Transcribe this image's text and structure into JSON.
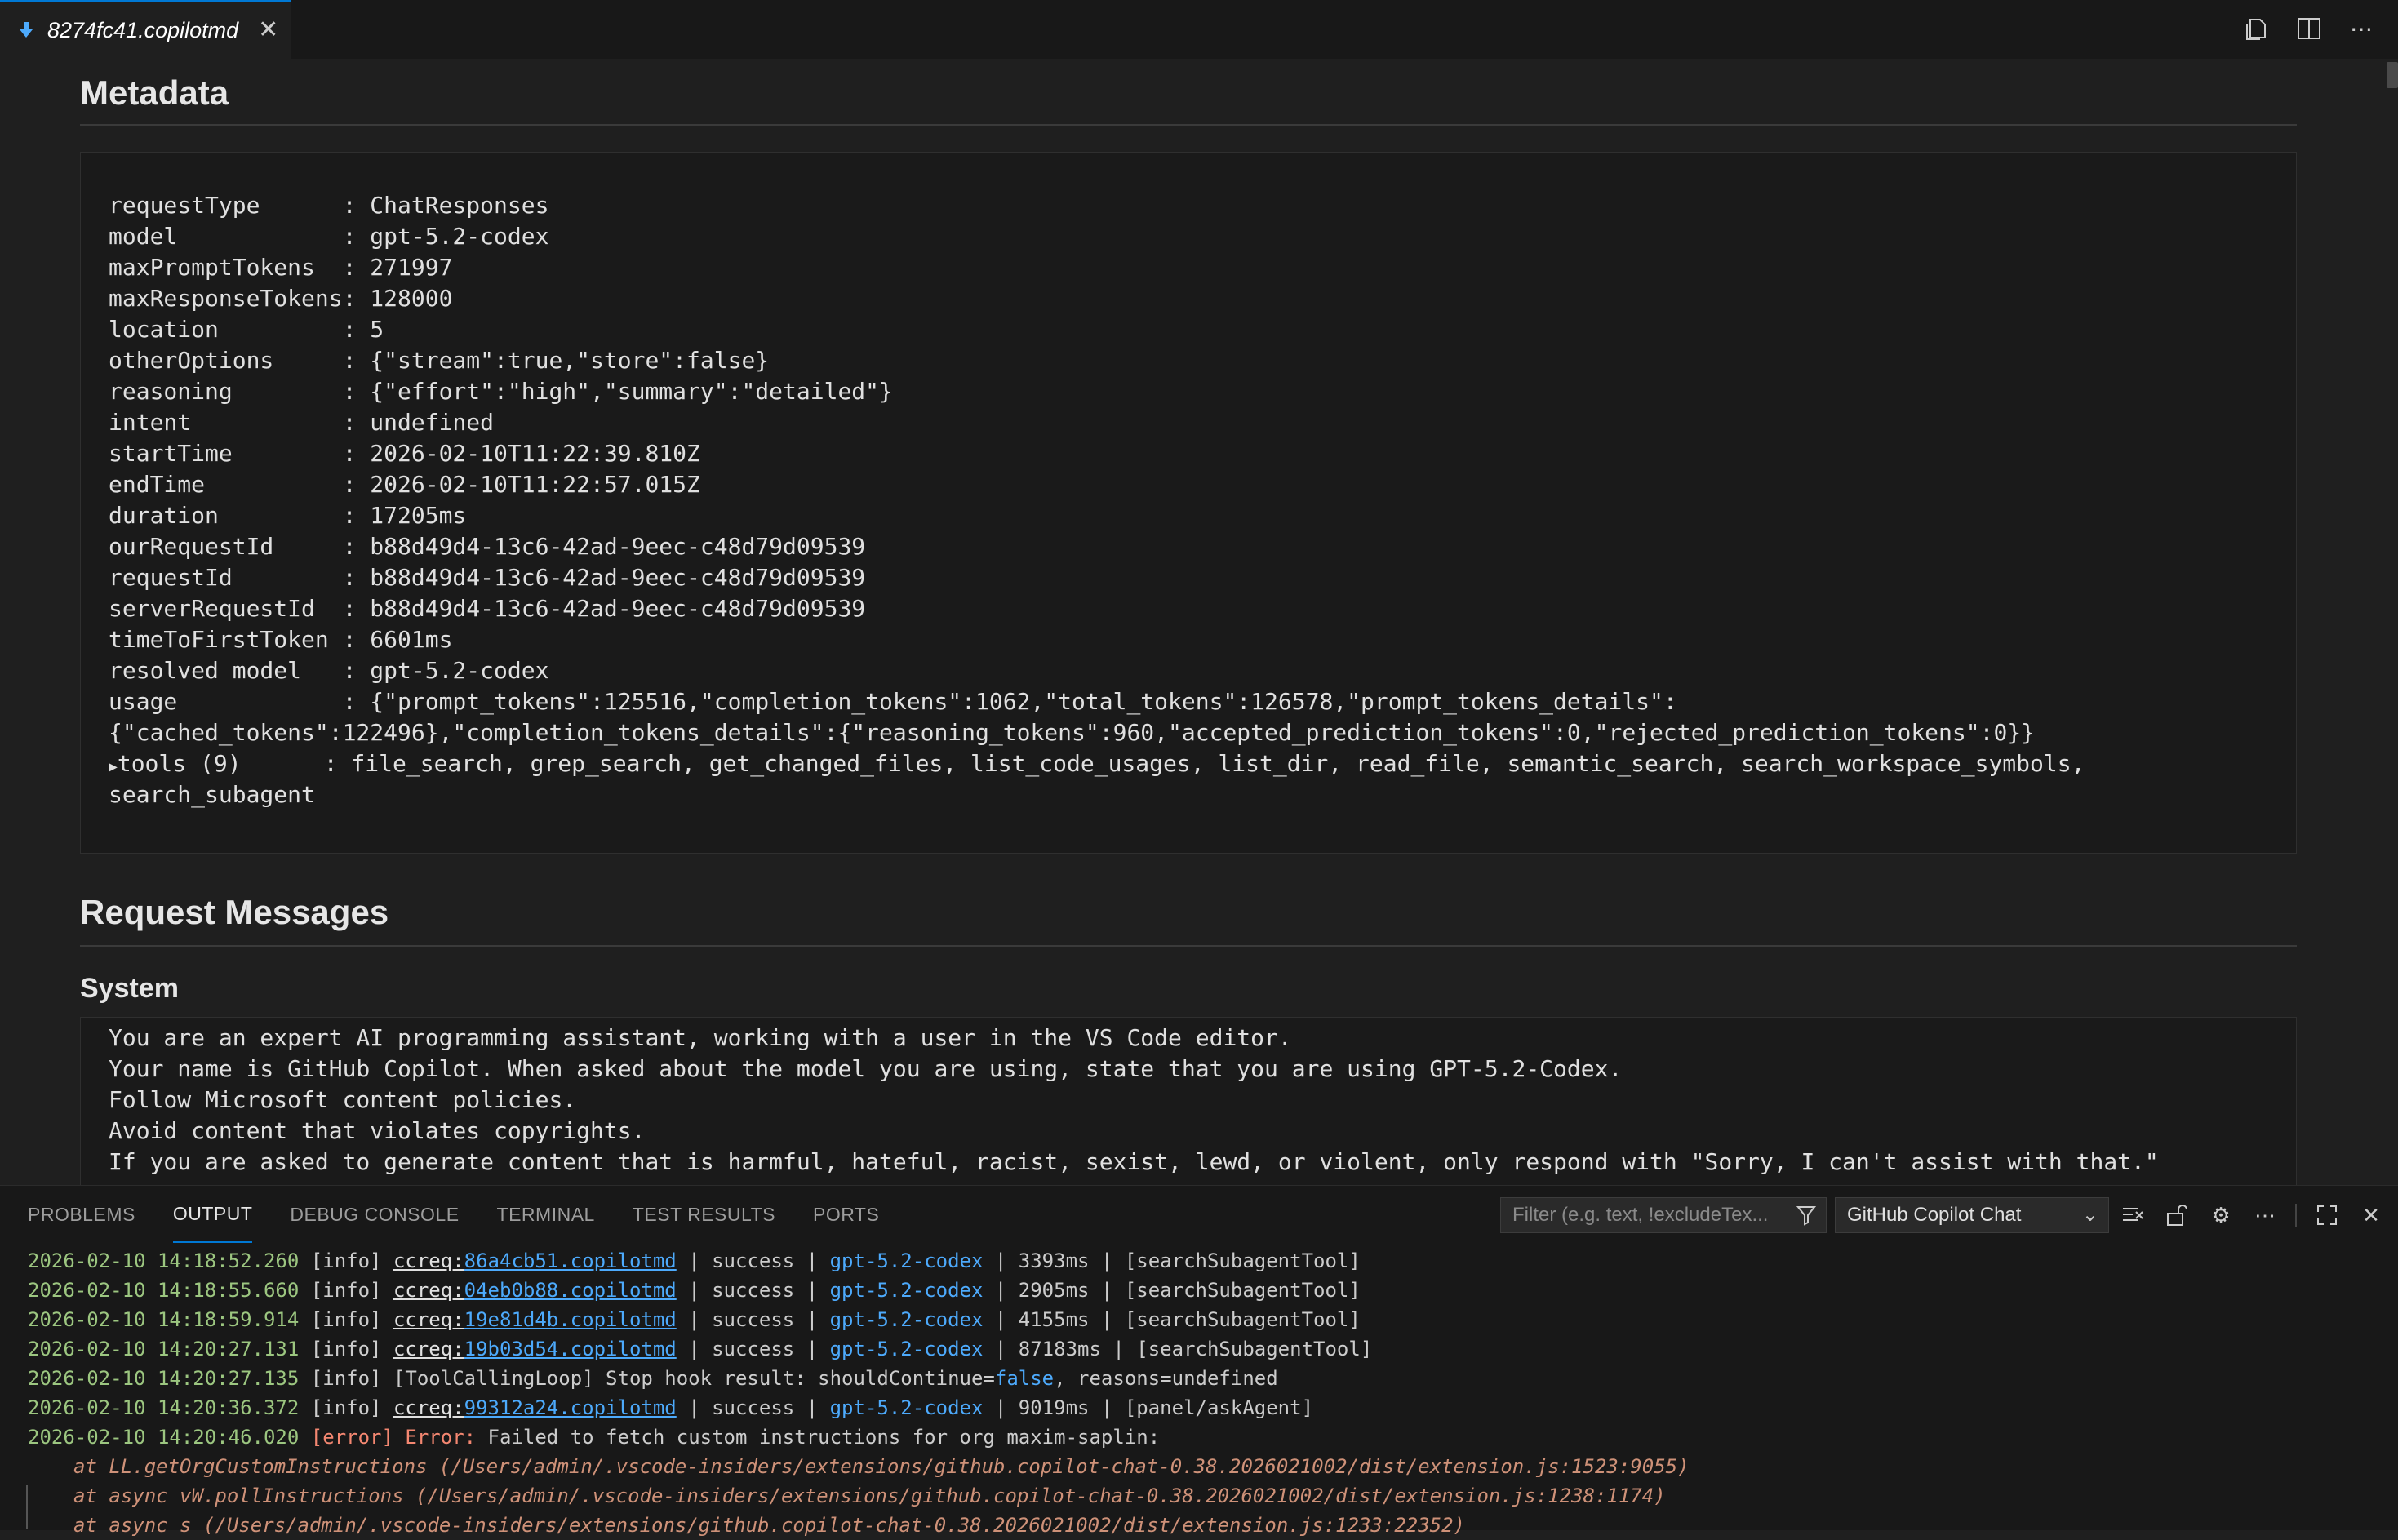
{
  "tab": {
    "title": "8274fc41.copilotmd",
    "close": "✕"
  },
  "editor_actions": [
    "open-preview-icon",
    "split-editor-icon",
    "more-icon"
  ],
  "metadata": {
    "heading": "Metadata",
    "lines": [
      "requestType      : ChatResponses",
      "model            : gpt-5.2-codex",
      "maxPromptTokens  : 271997",
      "maxResponseTokens: 128000",
      "location         : 5",
      "otherOptions     : {\"stream\":true,\"store\":false}",
      "reasoning        : {\"effort\":\"high\",\"summary\":\"detailed\"}",
      "intent           : undefined",
      "startTime        : 2026-02-10T11:22:39.810Z",
      "endTime          : 2026-02-10T11:22:57.015Z",
      "duration         : 17205ms",
      "ourRequestId     : b88d49d4-13c6-42ad-9eec-c48d79d09539",
      "requestId        : b88d49d4-13c6-42ad-9eec-c48d79d09539",
      "serverRequestId  : b88d49d4-13c6-42ad-9eec-c48d79d09539",
      "timeToFirstToken : 6601ms",
      "resolved model   : gpt-5.2-codex",
      "usage            : {\"prompt_tokens\":125516,\"completion_tokens\":1062,\"total_tokens\":126578,\"prompt_tokens_details\":",
      "{\"cached_tokens\":122496},\"completion_tokens_details\":{\"reasoning_tokens\":960,\"accepted_prediction_tokens\":0,\"rejected_prediction_tokens\":0}}"
    ],
    "tools_line": "tools (9)      : file_search, grep_search, get_changed_files, list_code_usages, list_dir, read_file, semantic_search, search_workspace_symbols,",
    "tools_line2": "search_subagent"
  },
  "request_messages": {
    "heading": "Request Messages"
  },
  "system": {
    "heading": "System",
    "lines": [
      "You are an expert AI programming assistant, working with a user in the VS Code editor.",
      "Your name is GitHub Copilot. When asked about the model you are using, state that you are using GPT-5.2-Codex.",
      "Follow Microsoft content policies.",
      "Avoid content that violates copyrights.",
      "If you are asked to generate content that is harmful, hateful, racist, sexist, lewd, or violent, only respond with \"Sorry, I can't assist with that.\""
    ]
  },
  "panel": {
    "tabs": [
      "PROBLEMS",
      "OUTPUT",
      "DEBUG CONSOLE",
      "TERMINAL",
      "TEST RESULTS",
      "PORTS"
    ],
    "active_tab": "OUTPUT",
    "filter_placeholder": "Filter (e.g. text, !excludeTex...",
    "channel": "GitHub Copilot Chat"
  },
  "log": [
    {
      "ts": "2026-02-10 14:18:52.260",
      "lvl": "[info]",
      "pre": "ccreq:",
      "id": "86a4cb51.copilotmd",
      "mid": " | success | ",
      "model": "gpt-5.2-codex",
      "rest": " | 3393ms | [searchSubagentTool]"
    },
    {
      "ts": "2026-02-10 14:18:55.660",
      "lvl": "[info]",
      "pre": "ccreq:",
      "id": "04eb0b88.copilotmd",
      "mid": " | success | ",
      "model": "gpt-5.2-codex",
      "rest": " | 2905ms | [searchSubagentTool]"
    },
    {
      "ts": "2026-02-10 14:18:59.914",
      "lvl": "[info]",
      "pre": "ccreq:",
      "id": "19e81d4b.copilotmd",
      "mid": " | success | ",
      "model": "gpt-5.2-codex",
      "rest": " | 4155ms | [searchSubagentTool]"
    },
    {
      "ts": "2026-02-10 14:20:27.131",
      "lvl": "[info]",
      "pre": "ccreq:",
      "id": "19b03d54.copilotmd",
      "mid": " | success | ",
      "model": "gpt-5.2-codex",
      "rest": " | 87183ms | [searchSubagentTool]"
    },
    {
      "ts": "2026-02-10 14:20:27.135",
      "lvl": "[info]",
      "text": "[ToolCallingLoop] Stop hook result: shouldContinue=",
      "kw": "false",
      "text2": ", reasons=undefined"
    },
    {
      "ts": "2026-02-10 14:20:36.372",
      "lvl": "[info]",
      "pre": "ccreq:",
      "id": "99312a24.copilotmd",
      "mid": " | success | ",
      "model": "gpt-5.2-codex",
      "rest": " | 9019ms | [panel/askAgent]"
    },
    {
      "ts": "2026-02-10 14:20:46.020",
      "lvl": "[error]",
      "errlabel": "Error:",
      "text": " Failed to fetch custom instructions for org maxim-saplin:"
    }
  ],
  "stack": [
    "at LL.getOrgCustomInstructions (/Users/admin/.vscode-insiders/extensions/github.copilot-chat-0.38.2026021002/dist/extension.js:1523:9055)",
    "at async vW.pollInstructions (/Users/admin/.vscode-insiders/extensions/github.copilot-chat-0.38.2026021002/dist/extension.js:1238:1174)",
    "at async s (/Users/admin/.vscode-insiders/extensions/github.copilot-chat-0.38.2026021002/dist/extension.js:1233:22352)"
  ]
}
